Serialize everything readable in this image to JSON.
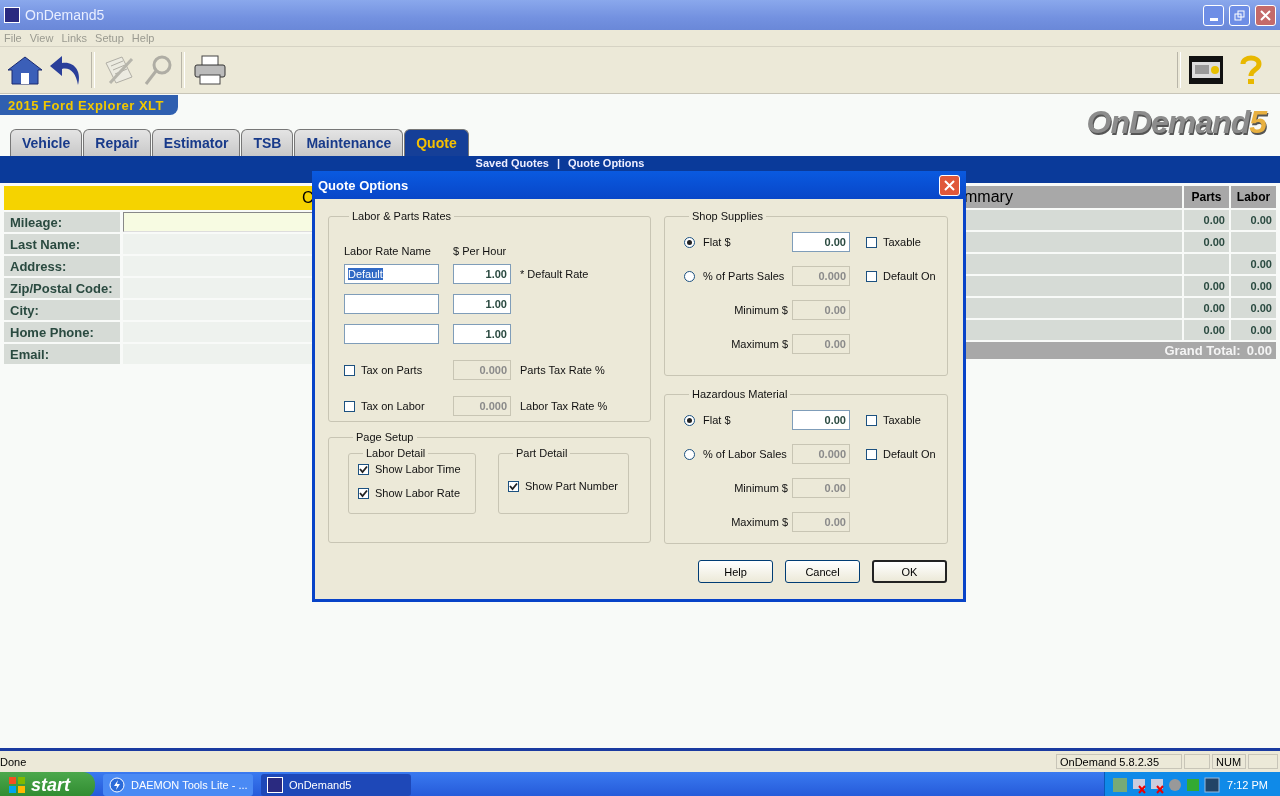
{
  "window": {
    "title": "OnDemand5"
  },
  "menu": [
    "File",
    "View",
    "Links",
    "Setup",
    "Help"
  ],
  "toolbar": [
    {
      "kind": "home",
      "disabled": false
    },
    {
      "kind": "back",
      "disabled": false
    },
    {
      "kind": "notes",
      "disabled": true
    },
    {
      "kind": "find",
      "disabled": true
    },
    {
      "kind": "print",
      "disabled": false
    }
  ],
  "vehicle": "2015 Ford Explorer XLT",
  "logo": {
    "name": "OnDemand",
    "number": "5"
  },
  "tabs": [
    {
      "label": "Vehicle",
      "selected": false
    },
    {
      "label": "Repair",
      "selected": false
    },
    {
      "label": "Estimator",
      "selected": false
    },
    {
      "label": "TSB",
      "selected": false
    },
    {
      "label": "Maintenance",
      "selected": false
    },
    {
      "label": "Quote",
      "selected": true
    }
  ],
  "subnav": {
    "links": [
      "Saved Quotes",
      "Quote Options"
    ],
    "separator": "|"
  },
  "customer": {
    "title": "C",
    "fields": [
      {
        "label": "Mileage:",
        "kind": "input"
      },
      {
        "label": "Last Name:",
        "kind": "text"
      },
      {
        "label": "Address:",
        "kind": "text"
      },
      {
        "label": "Zip/Postal Code:",
        "kind": "text"
      },
      {
        "label": "City:",
        "kind": "text"
      },
      {
        "label": "Home Phone:",
        "kind": "text"
      },
      {
        "label": "Email:",
        "kind": "text"
      }
    ]
  },
  "summary": {
    "title": "mmary",
    "columns": [
      "Parts",
      "Labor"
    ],
    "rows": [
      {
        "parts": "0.00",
        "labor": "0.00"
      },
      {
        "parts": "0.00"
      },
      {
        "labor": "0.00"
      },
      {
        "parts": "0.00",
        "labor": "0.00"
      },
      {
        "parts": "0.00",
        "labor": "0.00"
      },
      {
        "parts": "0.00",
        "labor": "0.00"
      }
    ],
    "grand_total_label": "Grand Total:",
    "grand_total": "0.00"
  },
  "dialog": {
    "title": "Quote Options",
    "rates": {
      "title": "Labor & Parts Rates",
      "name_header": "Labor Rate Name",
      "rate_header": "$ Per Hour",
      "rows": [
        {
          "name": "Default",
          "name_selected": true,
          "rate": "1.00",
          "note": "* Default Rate"
        },
        {
          "rate": "1.00"
        },
        {
          "rate": "1.00"
        }
      ],
      "taxes": [
        {
          "label": "Tax on Parts",
          "checked": false,
          "value": "0.000",
          "disabled": true,
          "rate_label": "Parts Tax Rate %"
        },
        {
          "label": "Tax on Labor",
          "checked": false,
          "value": "0.000",
          "disabled": true,
          "rate_label": "Labor Tax Rate %"
        }
      ]
    },
    "page_setup": {
      "title": "Page Setup",
      "groups": [
        {
          "title": "Labor Detail",
          "options": [
            {
              "label": "Show Labor Time",
              "checked": true
            },
            {
              "label": "Show Labor Rate",
              "checked": true
            }
          ]
        },
        {
          "title": "Part Detail",
          "options": [
            {
              "label": "Show Part Number",
              "checked": true
            }
          ]
        }
      ]
    },
    "charges": [
      {
        "title": "Shop Supplies",
        "options": [
          {
            "label": "Flat $",
            "selected": true,
            "value": "0.00",
            "disabled": false,
            "check_label": "Taxable",
            "checked": false
          },
          {
            "label": "% of Parts Sales",
            "selected": false,
            "value": "0.000",
            "disabled": true,
            "check_label": "Default On",
            "checked": false
          }
        ],
        "limits": [
          {
            "label": "Minimum $",
            "value": "0.00",
            "disabled": true
          },
          {
            "label": "Maximum $",
            "value": "0.00",
            "disabled": true
          }
        ]
      },
      {
        "title": "Hazardous Material",
        "options": [
          {
            "label": "Flat $",
            "selected": true,
            "value": "0.00",
            "disabled": false,
            "check_label": "Taxable",
            "checked": false
          },
          {
            "label": "% of Labor Sales",
            "selected": false,
            "value": "0.000",
            "disabled": true,
            "check_label": "Default On",
            "checked": false
          }
        ],
        "limits": [
          {
            "label": "Minimum $",
            "value": "0.00",
            "disabled": true
          },
          {
            "label": "Maximum $",
            "value": "0.00",
            "disabled": true
          }
        ]
      }
    ],
    "buttons": [
      {
        "label": "Help",
        "default": false
      },
      {
        "label": "Cancel",
        "default": false
      },
      {
        "label": "OK",
        "default": true
      }
    ]
  },
  "status_bar": {
    "text": "Done",
    "version": "OnDemand 5.8.2.35",
    "num": "NUM"
  },
  "taskbar": {
    "start": "start",
    "items": [
      {
        "label": "DAEMON Tools Lite - ...",
        "kind": "daemon",
        "selected": false
      },
      {
        "label": "OnDemand5",
        "kind": "ods",
        "selected": true
      }
    ],
    "clock": "7:12 PM"
  }
}
